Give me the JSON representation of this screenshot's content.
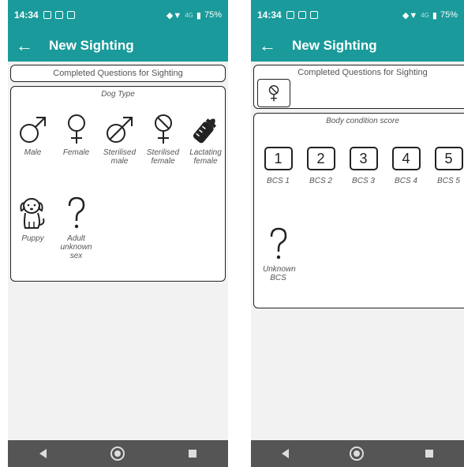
{
  "status": {
    "time": "14:34",
    "battery": "75%",
    "network": "4G"
  },
  "appbar": {
    "back_icon": "arrow-left-icon",
    "title": "New Sighting"
  },
  "left": {
    "completed_label": "Completed Questions for Sighting",
    "panel_title": "Dog Type",
    "options": [
      {
        "label": "Male",
        "icon": "male-symbol-icon"
      },
      {
        "label": "Female",
        "icon": "female-symbol-icon"
      },
      {
        "label": "Sterilised male",
        "icon": "sterilised-male-icon"
      },
      {
        "label": "Sterilised female",
        "icon": "sterilised-female-icon"
      },
      {
        "label": "Lactating female",
        "icon": "baby-bottle-icon"
      },
      {
        "label": "Puppy",
        "icon": "puppy-icon"
      },
      {
        "label": "Adult unknown sex",
        "icon": "question-mark-icon"
      }
    ]
  },
  "right": {
    "completed_label": "Completed Questions for Sighting",
    "selected_answer_icon": "sterilised-female-icon",
    "panel_title": "Body condition score",
    "options": [
      {
        "number": "1",
        "label": "BCS 1"
      },
      {
        "number": "2",
        "label": "BCS 2"
      },
      {
        "number": "3",
        "label": "BCS 3"
      },
      {
        "number": "4",
        "label": "BCS 4"
      },
      {
        "number": "5",
        "label": "BCS 5"
      }
    ],
    "unknown": {
      "label": "Unknown BCS",
      "icon": "question-mark-icon"
    }
  },
  "colors": {
    "app_bar": "#1a9a9a",
    "nav_bar": "#555555",
    "background": "#f2f2f2"
  }
}
